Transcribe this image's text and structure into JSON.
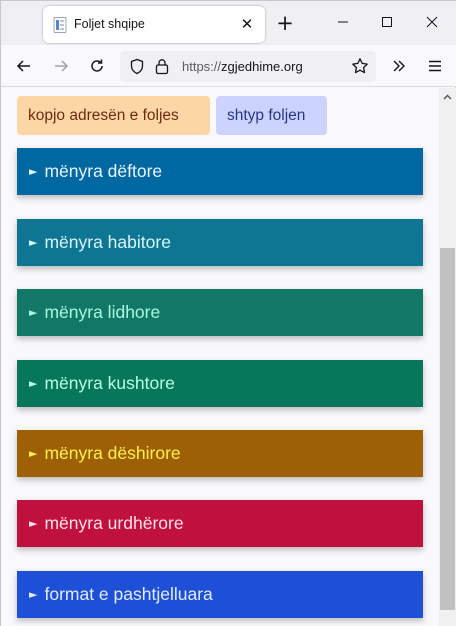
{
  "browser": {
    "tab_title": "Foljet shqipe",
    "tab_close": "✕",
    "new_tab": "+",
    "url_scheme": "https://",
    "url_host": "zgjedhime.org"
  },
  "buttons": {
    "copy_label": "kopjo adresën e foljes",
    "print_label": "shtyp foljen"
  },
  "sections": [
    {
      "label": "mënyra dëftore",
      "bg": "#0068a0",
      "fg": "#e8f4ff"
    },
    {
      "label": "mënyra habitore",
      "bg": "#0e7592",
      "fg": "#d7f6ff"
    },
    {
      "label": "mënyra lidhore",
      "bg": "#117767",
      "fg": "#a9f7de"
    },
    {
      "label": "mënyra kushtore",
      "bg": "#06775a",
      "fg": "#b6ffe0"
    },
    {
      "label": "mënyra dëshirore",
      "bg": "#9e6006",
      "fg": "#fff14a"
    },
    {
      "label": "mënyra urdhërore",
      "bg": "#c0103e",
      "fg": "#ffe0e8"
    },
    {
      "label": "format e pashtjelluara",
      "bg": "#1d4fd7",
      "fg": "#e2ecff"
    }
  ],
  "section_arrow": "►",
  "colors": {
    "tabstrip": "#f0f0f4",
    "copy_button": "#fdd6a6",
    "print_button": "#cdd3ff"
  }
}
